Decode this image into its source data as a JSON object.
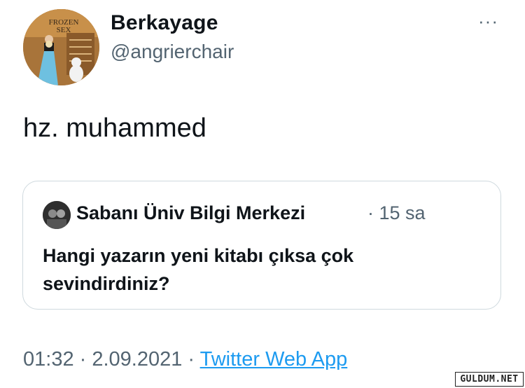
{
  "tweet": {
    "author": {
      "display_name": "Berkayage",
      "handle": "@angrierchair",
      "avatar_sign_text": [
        "FROZEN",
        "SEX"
      ]
    },
    "more_label": "···",
    "text": "hz. muhammed",
    "quoted": {
      "author_name": "Sabanı Üniv Bilgi Merkezi",
      "separator": "·",
      "time_ago": "15 sa",
      "text": "Hangi yazarın yeni kitabı çıksa çok sevindirdiniz?"
    },
    "footer": {
      "time": "01:32",
      "dot1": " · ",
      "date": "2.09.2021",
      "dot2": " · ",
      "source": "Twitter Web App"
    }
  },
  "watermark": "GULDUM.NET"
}
